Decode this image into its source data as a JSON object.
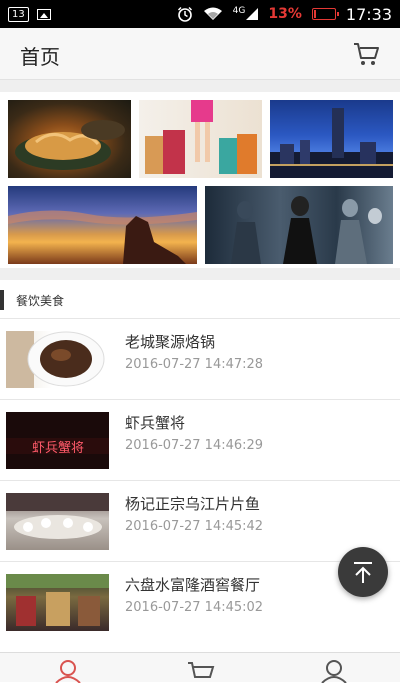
{
  "status_bar": {
    "sim_badge": "13",
    "network": "4G",
    "battery_percent_text": "13%",
    "battery_level": 0.13,
    "time": "17:33"
  },
  "header": {
    "title": "首页"
  },
  "section": {
    "title": "餐饮美食"
  },
  "articles": [
    {
      "title": "老城聚源烙锅",
      "time": "2016-07-27 14:47:28"
    },
    {
      "title": "虾兵蟹将",
      "time": "2016-07-27 14:46:29"
    },
    {
      "title": "杨记正宗乌江片片鱼",
      "time": "2016-07-27 14:45:42"
    },
    {
      "title": "六盘水富隆酒窖餐厅",
      "time": "2016-07-27 14:45:02"
    }
  ],
  "thumb_text": {
    "sign": "虾兵蟹将"
  },
  "colors": {
    "accent": "#d9534f",
    "battery": "#e53935",
    "fab": "#3a3a3a"
  }
}
